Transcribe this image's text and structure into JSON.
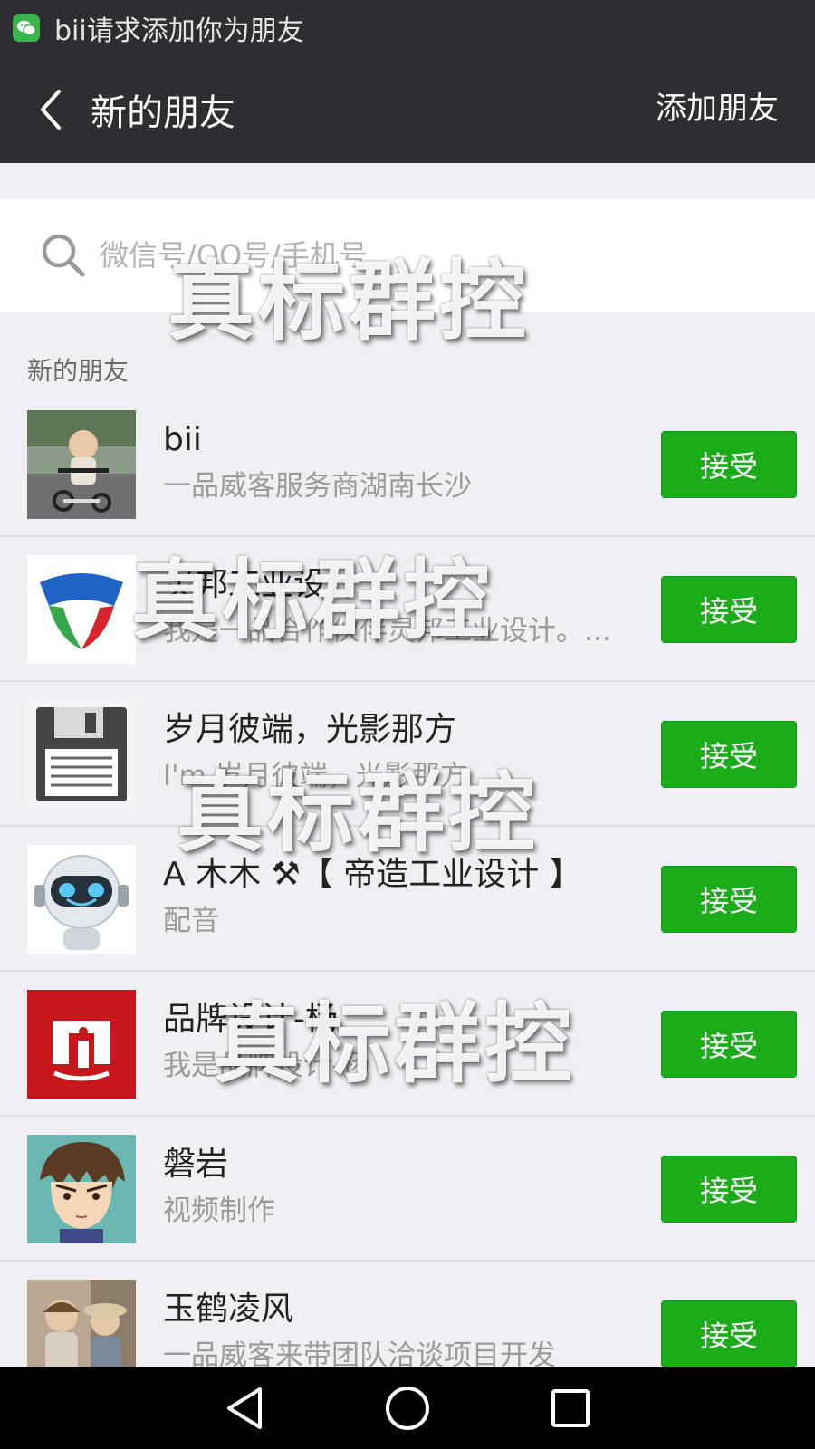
{
  "status_bar": {
    "notification": "bii请求添加你为朋友"
  },
  "header": {
    "title": "新的朋友",
    "add_friend_label": "添加朋友"
  },
  "search": {
    "placeholder": "微信号/QQ号/手机号"
  },
  "section_label": "新的朋友",
  "accept_label": "接受",
  "requests": [
    {
      "name": "bii",
      "message": "一品威客服务商湖南长沙"
    },
    {
      "name": "灵邦工业设计",
      "message": "我是一品合作伙伴灵邦工业设计。..."
    },
    {
      "name": "岁月彼端，光影那方",
      "message": "I'm 岁月彼端，光影那方"
    },
    {
      "name": "A  木木 ⚒【 帝造工业设计 】",
      "message": "配音"
    },
    {
      "name": "品牌设计-杨",
      "message": "我是品牌设计-杨"
    },
    {
      "name": "磐岩",
      "message": "视频制作"
    },
    {
      "name": "玉鹤凌风",
      "message": "一品威客来带团队洽谈项目开发"
    }
  ],
  "watermark": "真标群控",
  "colors": {
    "header_bg": "#2e2d32",
    "accept_green": "#1aad19",
    "page_bg": "#efeff4"
  },
  "icons": [
    "wechat-icon",
    "back-arrow-icon",
    "search-icon",
    "nav-back-icon",
    "nav-home-icon",
    "nav-recents-icon"
  ]
}
